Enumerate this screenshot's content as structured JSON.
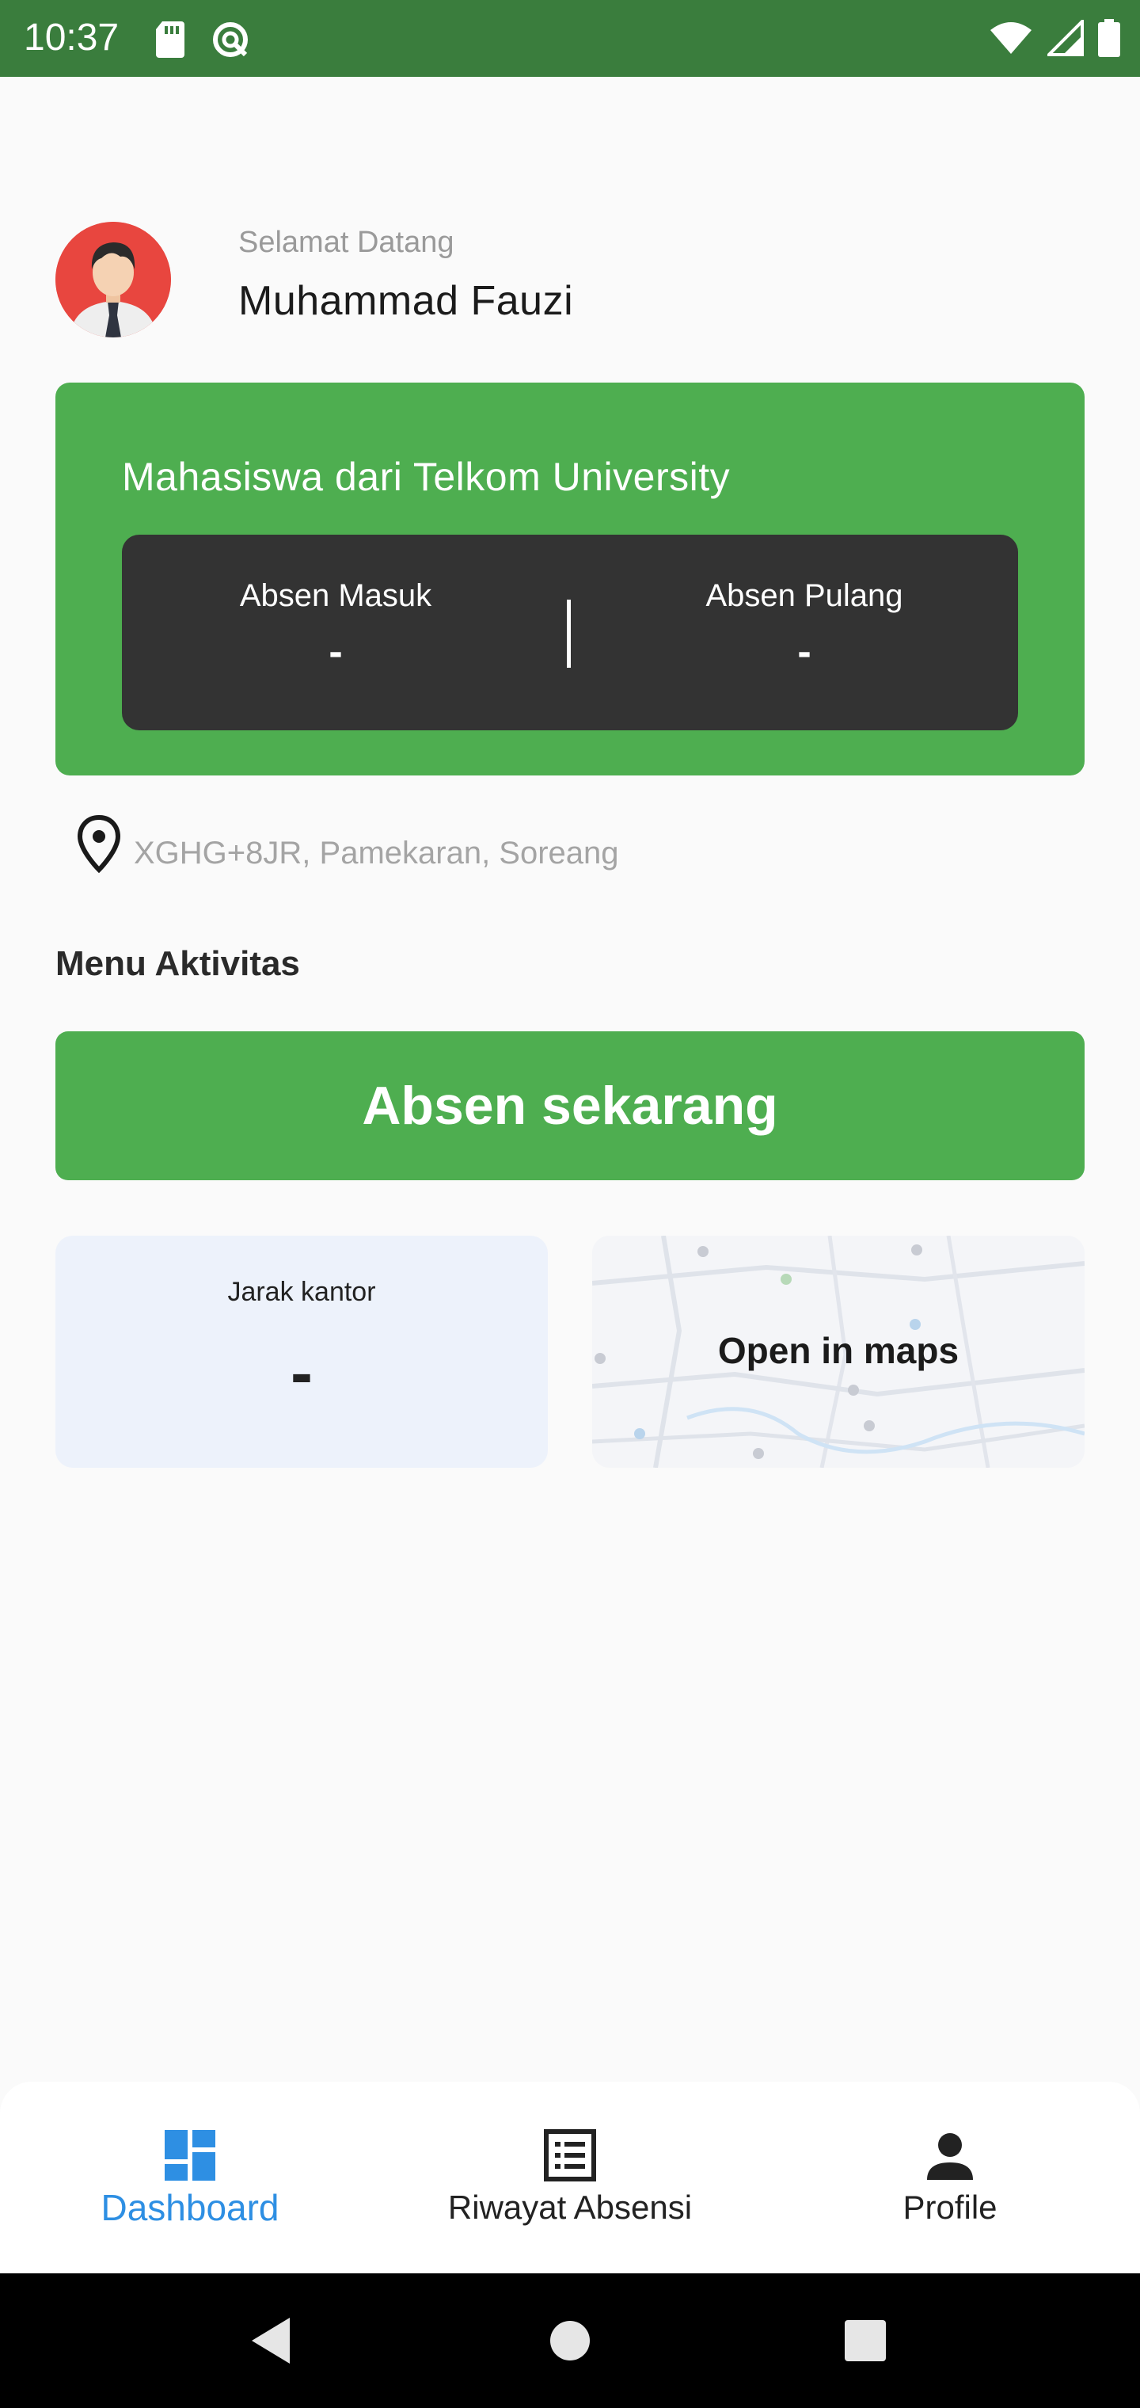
{
  "status_bar": {
    "time": "10:37",
    "icons": [
      "sd-card-icon",
      "sync-icon",
      "wifi-icon",
      "signal-icon",
      "battery-icon"
    ],
    "background": "#3a7d3d"
  },
  "header": {
    "greeting": "Selamat Datang",
    "name": "Muhammad Fauzi",
    "avatar_icon": "user-avatar-icon"
  },
  "status_card": {
    "title": "Mahasiswa dari Telkom University",
    "check_in": {
      "label": "Absen Masuk",
      "value": "-"
    },
    "check_out": {
      "label": "Absen Pulang",
      "value": "-"
    },
    "color": "#4eae50"
  },
  "location": {
    "icon": "map-pin-icon",
    "text": "XGHG+8JR, Pamekaran, Soreang"
  },
  "activity": {
    "section_title": "Menu Aktivitas",
    "primary_button": "Absen sekarang",
    "distance": {
      "label": "Jarak kantor",
      "value": "-"
    },
    "maps": {
      "label": "Open in maps"
    }
  },
  "bottom_nav": {
    "items": [
      {
        "label": "Dashboard",
        "icon": "dashboard-icon",
        "active": true
      },
      {
        "label": "Riwayat Absensi",
        "icon": "list-icon",
        "active": false
      },
      {
        "label": "Profile",
        "icon": "person-icon",
        "active": false
      }
    ],
    "active_color": "#2e8fe3"
  },
  "system_nav": {
    "icons": [
      "back-icon",
      "home-icon",
      "recents-icon"
    ]
  }
}
